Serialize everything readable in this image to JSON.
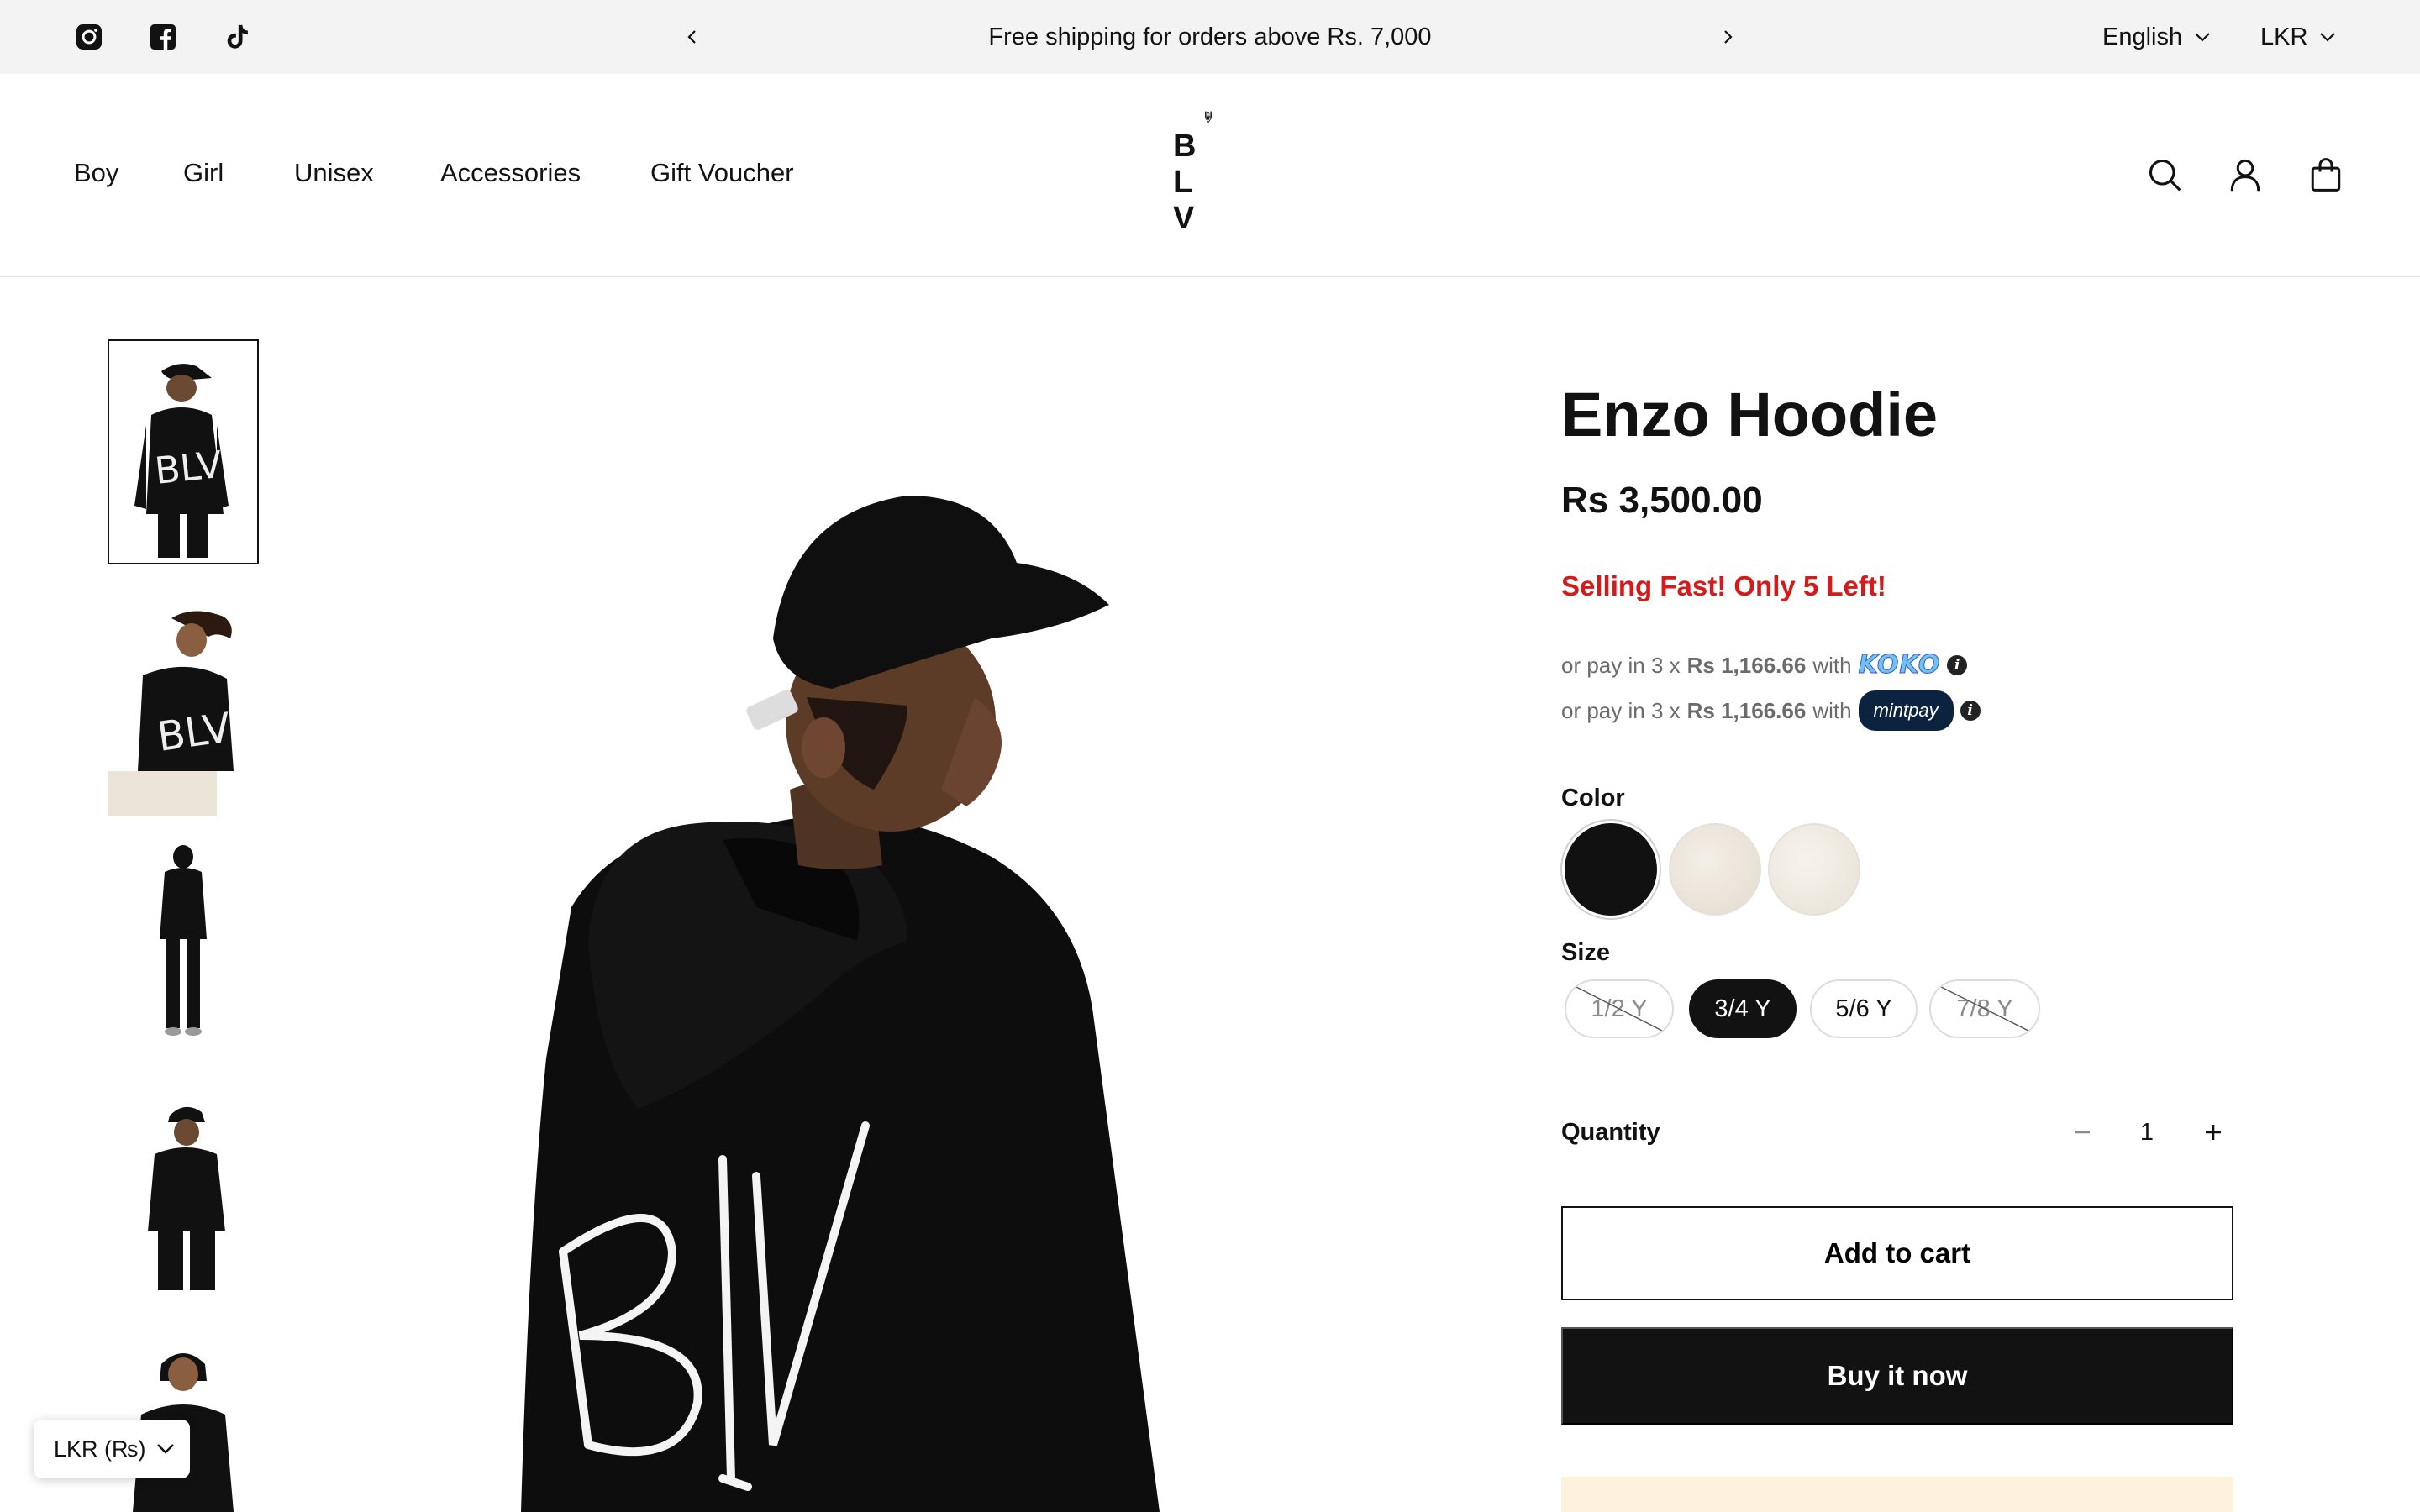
{
  "announcement": {
    "text": "Free shipping for orders above Rs. 7,000",
    "language": "English",
    "currency": "LKR",
    "social_icons": [
      "instagram-icon",
      "facebook-icon",
      "tiktok-icon"
    ]
  },
  "header": {
    "nav": [
      {
        "label": "Boy"
      },
      {
        "label": "Girl"
      },
      {
        "label": "Unisex"
      },
      {
        "label": "Accessories"
      },
      {
        "label": "Gift Voucher"
      }
    ],
    "logo_text": "B L V",
    "icons": [
      "search-icon",
      "account-icon",
      "cart-icon"
    ]
  },
  "gallery": {
    "thumbnail_count": 5,
    "active_index": 0,
    "main_print": "BLV"
  },
  "product": {
    "title": "Enzo Hoodie",
    "price": "Rs 3,500.00",
    "urgency": "Selling Fast! Only 5 Left!",
    "installments": [
      {
        "prefix": "or pay in 3 x",
        "amount": "Rs 1,166.66",
        "with": "with",
        "provider": "KOKO"
      },
      {
        "prefix": "or pay in 3 x",
        "amount": "Rs 1,166.66",
        "with": "with",
        "provider": "mintpay"
      }
    ],
    "color_label": "Color",
    "colors": [
      {
        "name": "Black",
        "hex": "#111111",
        "selected": true
      },
      {
        "name": "Cream",
        "hex": "#ece6dc",
        "selected": false
      },
      {
        "name": "Off-white",
        "hex": "#f1ece3",
        "selected": false
      }
    ],
    "size_label": "Size",
    "sizes": [
      {
        "label": "1/2 Y",
        "available": false,
        "selected": false
      },
      {
        "label": "3/4 Y",
        "available": true,
        "selected": true
      },
      {
        "label": "5/6 Y",
        "available": true,
        "selected": false
      },
      {
        "label": "7/8 Y",
        "available": false,
        "selected": false
      }
    ],
    "quantity_label": "Quantity",
    "quantity": "1",
    "add_to_cart": "Add to cart",
    "buy_now": "Buy it now"
  },
  "currency_widget": {
    "label": "LKR (₨)"
  },
  "colors": {
    "accent_red": "#d61a1a",
    "dark": "#121212",
    "announcement_bg": "#f3f3f3"
  }
}
